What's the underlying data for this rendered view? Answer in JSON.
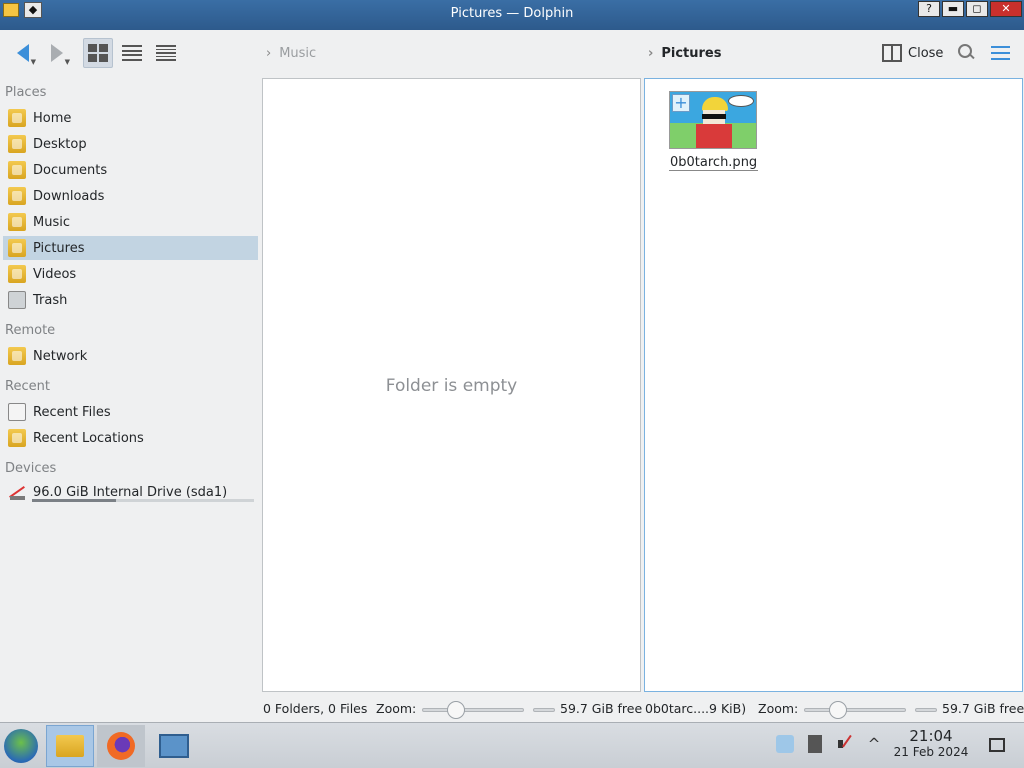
{
  "window": {
    "title": "Pictures — Dolphin"
  },
  "toolbar": {
    "back_icon": "back-arrow-icon",
    "forward_icon": "forward-arrow-icon",
    "views": [
      "icons-view",
      "compact-view",
      "details-view"
    ],
    "left_breadcrumb": "Music",
    "right_breadcrumb": "Pictures",
    "close_label": "Close"
  },
  "sidebar": {
    "sections": [
      {
        "header": "Places",
        "items": [
          {
            "label": "Home",
            "icon": "home-folder-icon"
          },
          {
            "label": "Desktop",
            "icon": "desktop-folder-icon"
          },
          {
            "label": "Documents",
            "icon": "documents-folder-icon"
          },
          {
            "label": "Downloads",
            "icon": "downloads-folder-icon"
          },
          {
            "label": "Music",
            "icon": "music-folder-icon"
          },
          {
            "label": "Pictures",
            "icon": "pictures-folder-icon",
            "selected": true
          },
          {
            "label": "Videos",
            "icon": "videos-folder-icon"
          },
          {
            "label": "Trash",
            "icon": "trash-icon"
          }
        ]
      },
      {
        "header": "Remote",
        "items": [
          {
            "label": "Network",
            "icon": "network-folder-icon"
          }
        ]
      },
      {
        "header": "Recent",
        "items": [
          {
            "label": "Recent Files",
            "icon": "recent-files-icon"
          },
          {
            "label": "Recent Locations",
            "icon": "recent-locations-icon"
          }
        ]
      },
      {
        "header": "Devices",
        "items": [
          {
            "label": "96.0 GiB Internal Drive (sda1)",
            "icon": "drive-icon",
            "usage_fraction": 0.38
          }
        ]
      }
    ]
  },
  "left_pane": {
    "empty_message": "Folder is empty"
  },
  "right_pane": {
    "files": [
      {
        "name": "0b0tarch.png"
      }
    ]
  },
  "left_status": {
    "summary": "0 Folders, 0 Files",
    "zoom_label": "Zoom:",
    "zoom_fraction": 0.3,
    "free_space": "59.7 GiB free"
  },
  "right_status": {
    "summary": "0b0tarc....9 KiB)",
    "zoom_label": "Zoom:",
    "zoom_fraction": 0.3,
    "free_space": "59.7 GiB free"
  },
  "taskbar": {
    "time": "21:04",
    "date": "21 Feb 2024"
  }
}
